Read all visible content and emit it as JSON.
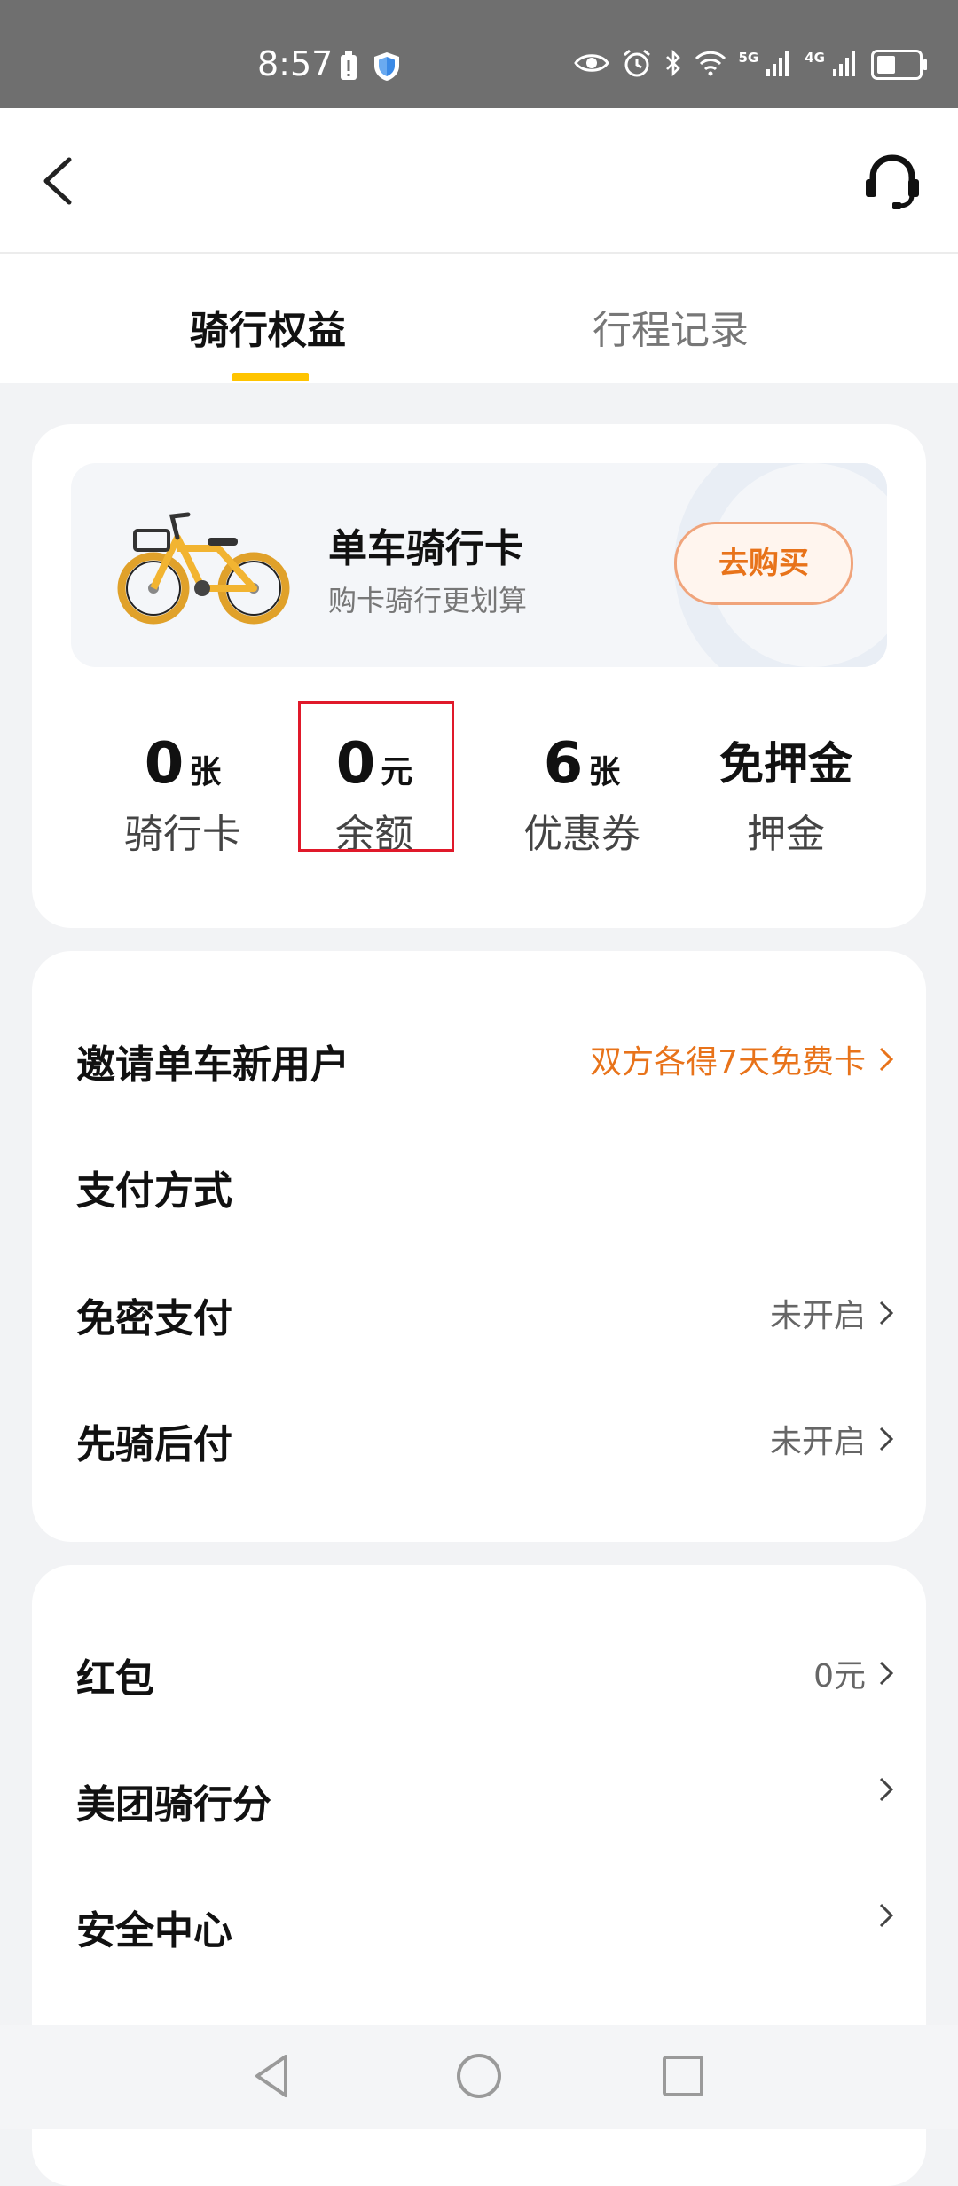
{
  "status_bar": {
    "time": "8:57",
    "network_1": "5G",
    "network_2": "4G"
  },
  "tabs": [
    {
      "label": "骑行权益",
      "active": true
    },
    {
      "label": "行程记录",
      "active": false
    }
  ],
  "promo": {
    "title": "单车骑行卡",
    "subtitle": "购卡骑行更划算",
    "button": "去购买"
  },
  "stats": [
    {
      "value": "0",
      "unit": "张",
      "label": "骑行卡"
    },
    {
      "value": "0",
      "unit": "元",
      "label": "余额"
    },
    {
      "value": "6",
      "unit": "张",
      "label": "优惠券"
    },
    {
      "value": "免押金",
      "unit": "",
      "label": "押金"
    }
  ],
  "menu_group_1": [
    {
      "label": "邀请单车新用户",
      "value": "双方各得7天免费卡"
    },
    {
      "label": "支付方式",
      "value": ""
    },
    {
      "label": "免密支付",
      "value": "未开启"
    },
    {
      "label": "先骑后付",
      "value": "未开启"
    }
  ],
  "menu_group_2": [
    {
      "label": "红包",
      "value": "0元"
    },
    {
      "label": "美团骑行分",
      "value": ""
    },
    {
      "label": "安全中心",
      "value": ""
    }
  ],
  "colors": {
    "accent_yellow": "#ffc400",
    "orange": "#e8731a",
    "highlight_red": "#e0192a"
  },
  "icons": [
    "back-arrow-icon",
    "headset-icon",
    "bicycle-icon",
    "chevron-right-icon",
    "nav-back-icon",
    "nav-home-icon",
    "nav-recents-icon"
  ]
}
